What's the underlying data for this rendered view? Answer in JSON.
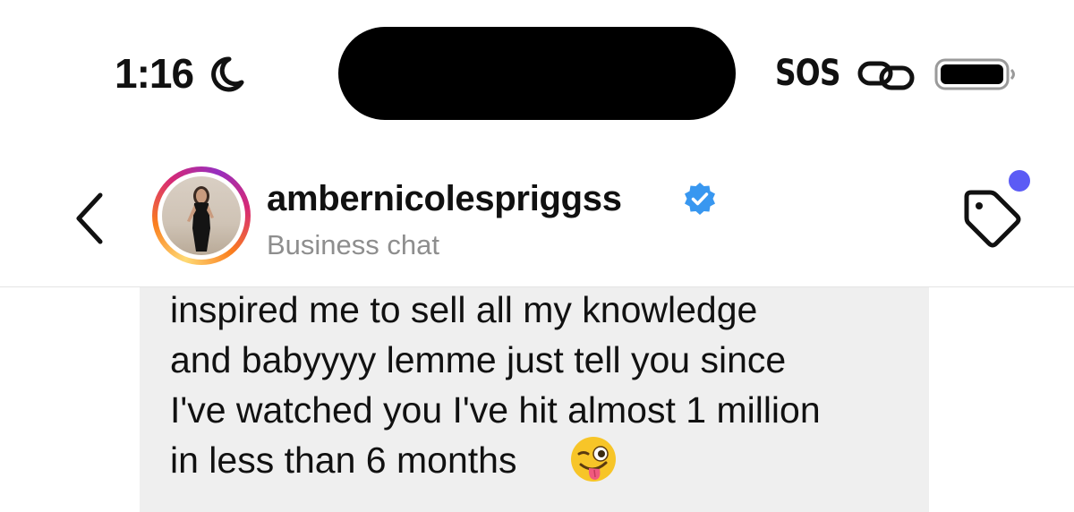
{
  "status_bar": {
    "time": "1:16",
    "sos": "SOS"
  },
  "header": {
    "username": "ambernicolespriggss",
    "subtitle": "Business chat"
  },
  "message": {
    "lines": [
      "inspired me to sell all my knowledge",
      "and babyyyy lemme just tell you since",
      "I've watched you I've hit almost 1 million",
      "in less than 6 months"
    ]
  },
  "icons": {
    "moon": "moon-icon",
    "link": "link-icon",
    "battery": "battery-icon",
    "back": "chevron-left-icon",
    "verified": "verified-badge-icon",
    "tag": "tag-icon",
    "emoji": "winking-face-with-tongue"
  },
  "colors": {
    "verified_blue": "#3897f0",
    "notification_dot": "#5b5bf5",
    "bubble_background": "#efefef",
    "subtitle_gray": "#8e8e8e"
  }
}
